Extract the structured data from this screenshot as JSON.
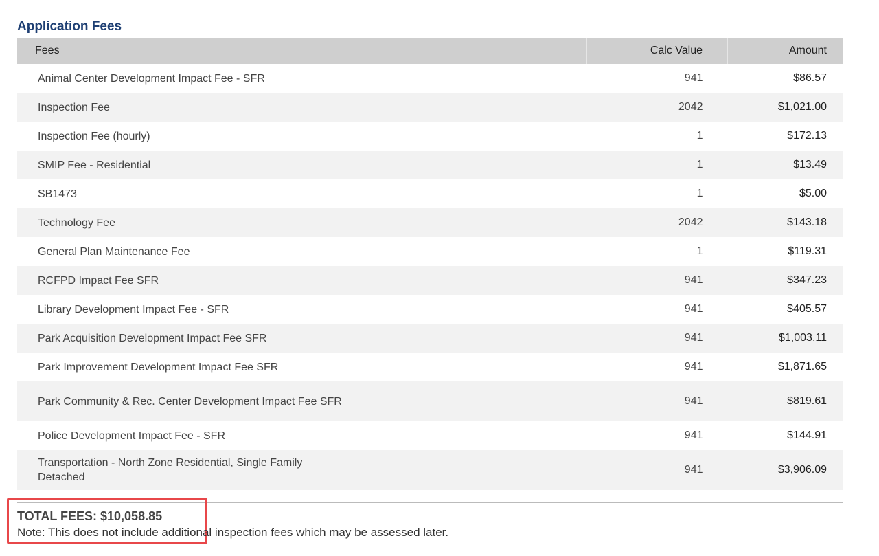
{
  "section_title": "Application Fees",
  "columns": {
    "fee": "Fees",
    "calc": "Calc Value",
    "amount": "Amount"
  },
  "rows": [
    {
      "name": "Animal Center Development Impact Fee - SFR",
      "calc": "941",
      "amount": "$86.57"
    },
    {
      "name": "Inspection Fee",
      "calc": "2042",
      "amount": "$1,021.00"
    },
    {
      "name": "Inspection Fee (hourly)",
      "calc": "1",
      "amount": "$172.13"
    },
    {
      "name": "SMIP Fee - Residential",
      "calc": "1",
      "amount": "$13.49"
    },
    {
      "name": "SB1473",
      "calc": "1",
      "amount": "$5.00"
    },
    {
      "name": "Technology Fee",
      "calc": "2042",
      "amount": "$143.18"
    },
    {
      "name": "General Plan Maintenance Fee",
      "calc": "1",
      "amount": "$119.31"
    },
    {
      "name": "RCFPD Impact Fee SFR",
      "calc": "941",
      "amount": "$347.23"
    },
    {
      "name": "Library Development Impact Fee - SFR",
      "calc": "941",
      "amount": "$405.57"
    },
    {
      "name": "Park Acquisition Development Impact Fee SFR",
      "calc": "941",
      "amount": "$1,003.11"
    },
    {
      "name": "Park Improvement Development Impact Fee SFR",
      "calc": "941",
      "amount": "$1,871.65"
    },
    {
      "name": "Park Community & Rec. Center Development Impact Fee SFR",
      "calc": "941",
      "amount": "$819.61"
    },
    {
      "name": "Police Development Impact Fee - SFR",
      "calc": "941",
      "amount": "$144.91"
    },
    {
      "name": "Transportation - North Zone Residential, Single Family Detached",
      "calc": "941",
      "amount": "$3,906.09"
    }
  ],
  "total": "TOTAL FEES: $10,058.85",
  "note": "Note: This does not include additional inspection fees which may be assessed later.",
  "highlight_color": "#e8474a",
  "title_color": "#1e3f73"
}
